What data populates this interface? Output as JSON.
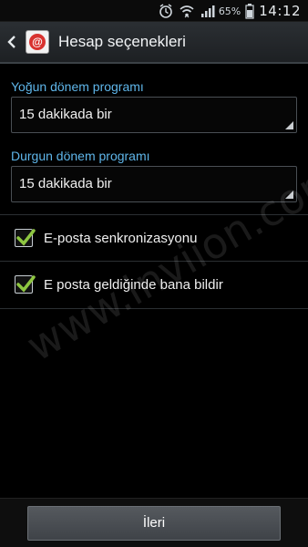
{
  "status_bar": {
    "battery": "65%",
    "time": "14:12",
    "icons": [
      "alarm-icon",
      "wifi-icon",
      "signal-icon",
      "battery-icon"
    ]
  },
  "action_bar": {
    "title": "Hesap seçenekleri",
    "app_icon": "email-app-icon",
    "app_icon_glyph": "@"
  },
  "settings": {
    "peak_label": "Yoğun dönem programı",
    "peak_value": "15 dakikada bir",
    "offpeak_label": "Durgun dönem programı",
    "offpeak_value": "15 dakikada bir",
    "sync_label": "E-posta senkronizasyonu",
    "sync_checked": true,
    "notify_label": "E posta geldiğinde bana bildir",
    "notify_checked": true
  },
  "watermark": "www.inviion.com",
  "footer": {
    "next_label": "İleri"
  },
  "colors": {
    "accent": "#5fb6ea",
    "check": "#8ec641",
    "app_icon": "#d8322f"
  }
}
